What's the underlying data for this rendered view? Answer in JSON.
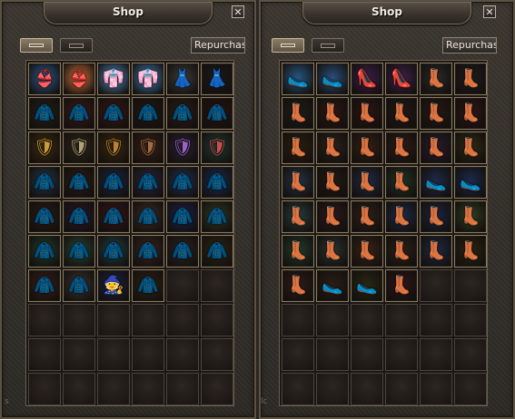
{
  "shops": [
    {
      "title": "Shop",
      "close_glyph": "✕",
      "repurchase_label": "Repurchas",
      "side_mark": "s",
      "rows": [
        [
          [
            "#2b5a8c",
            "👙",
            "#f1d6c2"
          ],
          [
            "#c7703a",
            "👙",
            "#e8b27a"
          ],
          [
            "#4e86b9",
            "👘",
            "#bfe0f4"
          ],
          [
            "#3f7fb3",
            "👘",
            "#cfe7fb"
          ],
          [
            "#3d3a38",
            "👗",
            "#f2f2f2"
          ],
          [
            "#1c1a1b",
            "👗",
            "#c9c4c4"
          ]
        ],
        [
          [
            "#23201a",
            "🧥",
            "#6c9c6c"
          ],
          [
            "#3d1a15",
            "🧥",
            "#b54a3c"
          ],
          [
            "#3a1714",
            "🧥",
            "#c2493f"
          ],
          [
            "#231812",
            "🧥",
            "#7e5231"
          ],
          [
            "#2e1d15",
            "🧥",
            "#8d5a34"
          ],
          [
            "#2b1211",
            "🧥",
            "#a8302b"
          ]
        ],
        [
          [
            "#3d2c10",
            "🛡",
            "#c99a3a"
          ],
          [
            "#2e2718",
            "🛡",
            "#b0a378"
          ],
          [
            "#3a2910",
            "🛡",
            "#b88334"
          ],
          [
            "#382016",
            "🛡",
            "#a36b3f"
          ],
          [
            "#2a2032",
            "🛡",
            "#9b62c6"
          ],
          [
            "#223a2f",
            "🛡",
            "#c94e4e"
          ]
        ],
        [
          [
            "#233546",
            "🧥",
            "#8aa7c0"
          ],
          [
            "#2b1c14",
            "🧥",
            "#7b4e2e"
          ],
          [
            "#1c2640",
            "🧥",
            "#7a8dc8"
          ],
          [
            "#27283d",
            "🧥",
            "#6b70a3"
          ],
          [
            "#22304e",
            "🧥",
            "#e8ecf4"
          ],
          [
            "#1b2a4e",
            "🧥",
            "#f1e3ec"
          ]
        ],
        [
          [
            "#2b1a12",
            "🧥",
            "#7c3c2c"
          ],
          [
            "#2a1726",
            "🧥",
            "#8a4b7c"
          ],
          [
            "#3b1418",
            "🧥",
            "#c13b44"
          ],
          [
            "#3c2a22",
            "🧥",
            "#caa37c"
          ],
          [
            "#1b2348",
            "🧥",
            "#e6d04a"
          ],
          [
            "#2f3a22",
            "🧥",
            "#d23c3c"
          ]
        ],
        [
          [
            "#223c2b",
            "🧥",
            "#c7352d"
          ],
          [
            "#294534",
            "🧥",
            "#98c4b4"
          ],
          [
            "#1f3e40",
            "🧥",
            "#7cc0b6"
          ],
          [
            "#3a2520",
            "🧥",
            "#b06a6a"
          ],
          [
            "#2a2424",
            "🧥",
            "#c9b4c8"
          ],
          [
            "#2e2512",
            "🧥",
            "#b88a30"
          ]
        ],
        [
          [
            "#3a1d18",
            "🧥",
            "#c84a35"
          ],
          [
            "#3a3330",
            "🧥",
            "#f0ebe6"
          ],
          [
            "#1c2240",
            "🧙",
            "#d8b142"
          ],
          [
            "#2e2212",
            "🧥",
            "#c07a34"
          ],
          null,
          null
        ],
        [
          null,
          null,
          null,
          null,
          null,
          null
        ],
        [
          null,
          null,
          null,
          null,
          null,
          null
        ],
        [
          null,
          null,
          null,
          null,
          null,
          null
        ]
      ]
    },
    {
      "title": "Shop",
      "close_glyph": "✕",
      "repurchase_label": "Repurchas",
      "side_mark": "lc",
      "rows": [
        [
          [
            "#275680",
            "🥿",
            "#d9b494"
          ],
          [
            "#2a4e7a",
            "🥿",
            "#e8c6a4"
          ],
          [
            "#3b1f4a",
            "👠",
            "#c86ac6"
          ],
          [
            "#3c2148",
            "👠",
            "#d470c8"
          ],
          [
            "#2a2a2a",
            "👢",
            "#ece6e0"
          ],
          [
            "#1f1d1d",
            "👢",
            "#8c7f7a"
          ]
        ],
        [
          [
            "#1f1d18",
            "👢",
            "#4c4a42"
          ],
          [
            "#2d1713",
            "👢",
            "#b03a30"
          ],
          [
            "#2a1612",
            "👢",
            "#b54034"
          ],
          [
            "#211a14",
            "👢",
            "#6e4d30"
          ],
          [
            "#261912",
            "👢",
            "#7e5431"
          ],
          [
            "#2e1514",
            "👢",
            "#a83a2c"
          ]
        ],
        [
          [
            "#2b2010",
            "👢",
            "#c28a3a"
          ],
          [
            "#2a231a",
            "👢",
            "#c2a25a"
          ],
          [
            "#352014",
            "👢",
            "#a0603c"
          ],
          [
            "#2f1c16",
            "👢",
            "#a16a48"
          ],
          [
            "#2a1c2c",
            "👢",
            "#b64a68"
          ],
          [
            "#2e2a16",
            "👢",
            "#c6ab3a"
          ]
        ],
        [
          [
            "#253344",
            "👢",
            "#8caac4"
          ],
          [
            "#221a14",
            "👢",
            "#6d4c2f"
          ],
          [
            "#1f2b44",
            "👢",
            "#7e8ec6"
          ],
          [
            "#223325",
            "👢",
            "#8fc27e"
          ],
          [
            "#1e2a48",
            "🥿",
            "#d9a0b4"
          ],
          [
            "#1c2a4c",
            "🥿",
            "#e8b6c4"
          ]
        ],
        [
          [
            "#253d3a",
            "👢",
            "#9fc6c0"
          ],
          [
            "#2a1a1c",
            "👢",
            "#8a5a56"
          ],
          [
            "#2e2018",
            "👢",
            "#b08060"
          ],
          [
            "#1e2a48",
            "👢",
            "#88a8d8"
          ],
          [
            "#1b2640",
            "👢",
            "#5f7cb0"
          ],
          [
            "#2f3e20",
            "👢",
            "#cc3c3c"
          ]
        ],
        [
          [
            "#223c2b",
            "👢",
            "#c7352d"
          ],
          [
            "#2a3430",
            "👢",
            "#e6dfd8"
          ],
          [
            "#3a2418",
            "👢",
            "#9e6840"
          ],
          [
            "#2e2018",
            "👢",
            "#a97c58"
          ],
          [
            "#202a44",
            "👢",
            "#7d8fc6"
          ],
          [
            "#2c2412",
            "👢",
            "#b88a30"
          ]
        ],
        [
          [
            "#2e1c18",
            "👢",
            "#c8443a"
          ],
          [
            "#2a1e16",
            "🥿",
            "#d28a4a"
          ],
          [
            "#2a2614",
            "🥿",
            "#e0c050"
          ],
          [
            "#2e1616",
            "👢",
            "#b43a3a"
          ],
          null,
          null
        ],
        [
          null,
          null,
          null,
          null,
          null,
          null
        ],
        [
          null,
          null,
          null,
          null,
          null,
          null
        ],
        [
          null,
          null,
          null,
          null,
          null,
          null
        ]
      ]
    }
  ]
}
